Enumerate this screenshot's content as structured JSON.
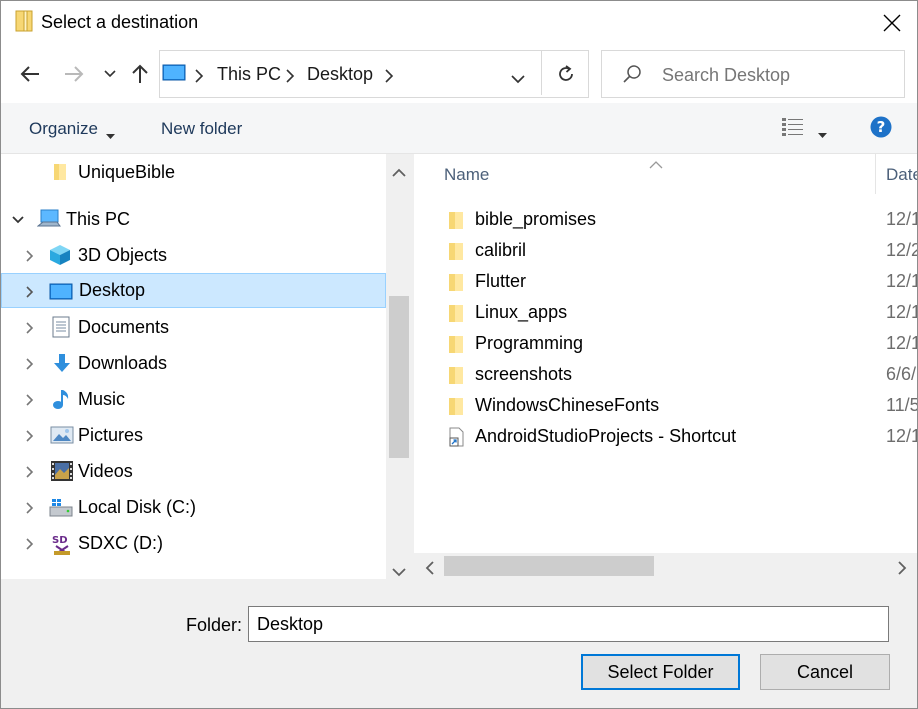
{
  "window": {
    "title": "Select a destination"
  },
  "address": {
    "breadcrumbs": [
      "This PC",
      "Desktop"
    ]
  },
  "search": {
    "placeholder": "Search Desktop"
  },
  "toolbar": {
    "organize_label": "Organize",
    "new_folder_label": "New folder"
  },
  "tree": {
    "items": [
      {
        "label": "UniqueBible",
        "icon": "folder-icon"
      },
      {
        "label": "This PC",
        "icon": "computer-icon",
        "expanded": true
      },
      {
        "label": "3D Objects",
        "icon": "3d-objects-icon"
      },
      {
        "label": "Desktop",
        "icon": "desktop-icon",
        "selected": true
      },
      {
        "label": "Documents",
        "icon": "documents-icon"
      },
      {
        "label": "Downloads",
        "icon": "downloads-icon"
      },
      {
        "label": "Music",
        "icon": "music-icon"
      },
      {
        "label": "Pictures",
        "icon": "pictures-icon"
      },
      {
        "label": "Videos",
        "icon": "videos-icon"
      },
      {
        "label": "Local Disk (C:)",
        "icon": "local-disk-icon"
      },
      {
        "label": "SDXC (D:)",
        "icon": "sd-card-icon"
      }
    ]
  },
  "list": {
    "columns": [
      "Name",
      "Date"
    ],
    "rows": [
      {
        "name": "bible_promises",
        "date": "12/1",
        "icon": "folder-icon"
      },
      {
        "name": "calibril",
        "date": "12/2",
        "icon": "folder-icon"
      },
      {
        "name": "Flutter",
        "date": "12/1",
        "icon": "folder-icon"
      },
      {
        "name": "Linux_apps",
        "date": "12/1",
        "icon": "folder-icon"
      },
      {
        "name": "Programming",
        "date": "12/1",
        "icon": "folder-icon"
      },
      {
        "name": "screenshots",
        "date": "6/6/",
        "icon": "folder-icon"
      },
      {
        "name": "WindowsChineseFonts",
        "date": "11/5",
        "icon": "folder-icon"
      },
      {
        "name": "AndroidStudioProjects - Shortcut",
        "date": "12/1",
        "icon": "shortcut-icon"
      }
    ]
  },
  "footer": {
    "folder_label": "Folder:",
    "folder_value": "Desktop",
    "select_label": "Select Folder",
    "cancel_label": "Cancel"
  },
  "colors": {
    "accent": "#0078d7",
    "selection": "#cce8ff",
    "help": "#1e72c8"
  }
}
